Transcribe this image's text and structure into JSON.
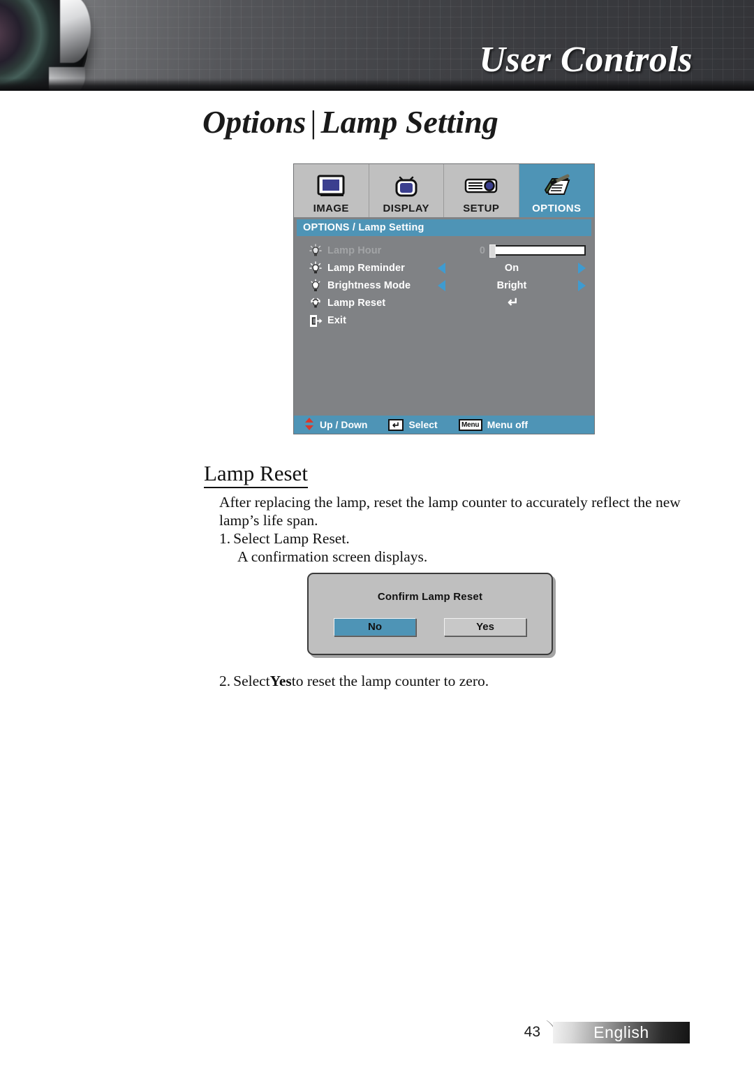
{
  "header": {
    "title": "User Controls",
    "lens_icon": "projector-lens-photo"
  },
  "page_title": {
    "section": "Options",
    "separator": "|",
    "subsection": "Lamp Setting"
  },
  "osd": {
    "tabs": [
      {
        "label": "IMAGE",
        "icon": "monitor-icon",
        "selected": false
      },
      {
        "label": "DISPLAY",
        "icon": "tv-icon",
        "selected": false
      },
      {
        "label": "SETUP",
        "icon": "projector-icon",
        "selected": false
      },
      {
        "label": "OPTIONS",
        "icon": "notepad-pen-icon",
        "selected": true
      }
    ],
    "breadcrumb": "OPTIONS / Lamp Setting",
    "rows": [
      {
        "label": "Lamp Hour",
        "icon": "lamp-icon",
        "type": "slider",
        "value": "0",
        "disabled": true
      },
      {
        "label": "Lamp Reminder",
        "icon": "lamp-icon",
        "type": "spinner",
        "value": "On",
        "disabled": false
      },
      {
        "label": "Brightness Mode",
        "icon": "lamp-bright-icon",
        "type": "spinner",
        "value": "Bright",
        "disabled": false
      },
      {
        "label": "Lamp Reset",
        "icon": "lamp-reset-icon",
        "type": "enter",
        "value": "↵",
        "disabled": false
      },
      {
        "label": "Exit",
        "icon": "exit-door-icon",
        "type": "none",
        "value": "",
        "disabled": false
      }
    ],
    "status": [
      {
        "label": "Up / Down",
        "icon": "up-down-arrow-icon",
        "key": ""
      },
      {
        "label": "Select",
        "icon": "enter-key-icon",
        "key": "↵"
      },
      {
        "label": "Menu off",
        "icon": "menu-key-icon",
        "key": "Menu"
      }
    ],
    "colors": {
      "accent": "#4e94b6",
      "panel": "#808285",
      "tab_bar": "#c0c0c0",
      "disabled_text": "#a2a4a6",
      "arrow": "#3f9bd0",
      "up_down_arrow": "#d8392b"
    }
  },
  "content": {
    "heading": "Lamp Reset",
    "paragraph": "After replacing the lamp, reset the lamp counter to accurately reflect the new lamp’s life span.",
    "step1_num": "1.",
    "step1_text": "Select Lamp Reset.",
    "step1_sub": "A confirmation screen displays.",
    "step2_num": "2.",
    "step2_pre": "Select ",
    "step2_bold": "Yes",
    "step2_post": " to reset the lamp counter to zero."
  },
  "confirm_dialog": {
    "title": "Confirm Lamp Reset",
    "buttons": [
      {
        "label": "No",
        "selected": true
      },
      {
        "label": "Yes",
        "selected": false
      }
    ]
  },
  "footer": {
    "page_number": "43",
    "language": "English"
  }
}
